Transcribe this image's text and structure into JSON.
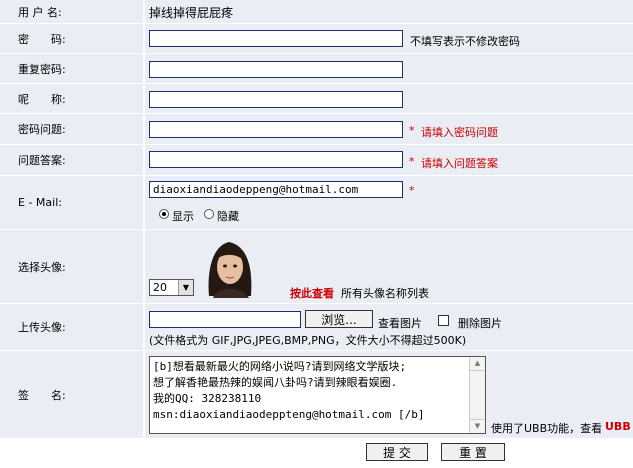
{
  "username": {
    "label": "用 户 名:",
    "value": "掉线掉得屁屁疼"
  },
  "password": {
    "label": "密　　码:",
    "value": "",
    "hint": "不填写表示不修改密码"
  },
  "repeat_password": {
    "label": "重复密码:",
    "value": ""
  },
  "nickname": {
    "label": "呢　　称:",
    "value": ""
  },
  "question": {
    "label": "密码问题:",
    "value": "",
    "required_mark": "*",
    "hint": "请填入密码问题"
  },
  "answer": {
    "label": "问题答案:",
    "value": "",
    "required_mark": "*",
    "hint": "请填入问题答案"
  },
  "email": {
    "label": "E - Mail:",
    "value": "diaoxiandiaodeppeng@hotmail.com",
    "required_mark": "*",
    "show_label": "显示",
    "hide_label": "隐藏",
    "selected": "显示"
  },
  "avatar": {
    "label": "选择头像:",
    "selected": "20",
    "link_text": "按此查看",
    "link_suffix": "所有头像名称列表"
  },
  "upload": {
    "label": "上传头像:",
    "value": "",
    "browse_label": "浏览...",
    "view_label": "查看图片",
    "delete_label": "删除图片",
    "note": "(文件格式为 GIF,JPG,JPEG,BMP,PNG，文件大小不得超过500K)"
  },
  "signature": {
    "label": "签　　名:",
    "lines": [
      "[b]想看最新最火的网络小说吗?请到网络文学版块;",
      "想了解香艳最热辣的娱闻八卦吗?请到辣眼看娱圈.",
      "我的QQ: 328238110",
      "msn:diaoxiandiaodeppteng@hotmail.com [/b]"
    ],
    "ubb_note": "使用了UBB功能，查看",
    "ubb_link": "UBB"
  },
  "actions": {
    "submit": "提 交",
    "reset": "重 置"
  },
  "colors": {
    "row_bg": "#eaedf3",
    "input_border": "#1f2f6a",
    "required": "#cc0000"
  }
}
